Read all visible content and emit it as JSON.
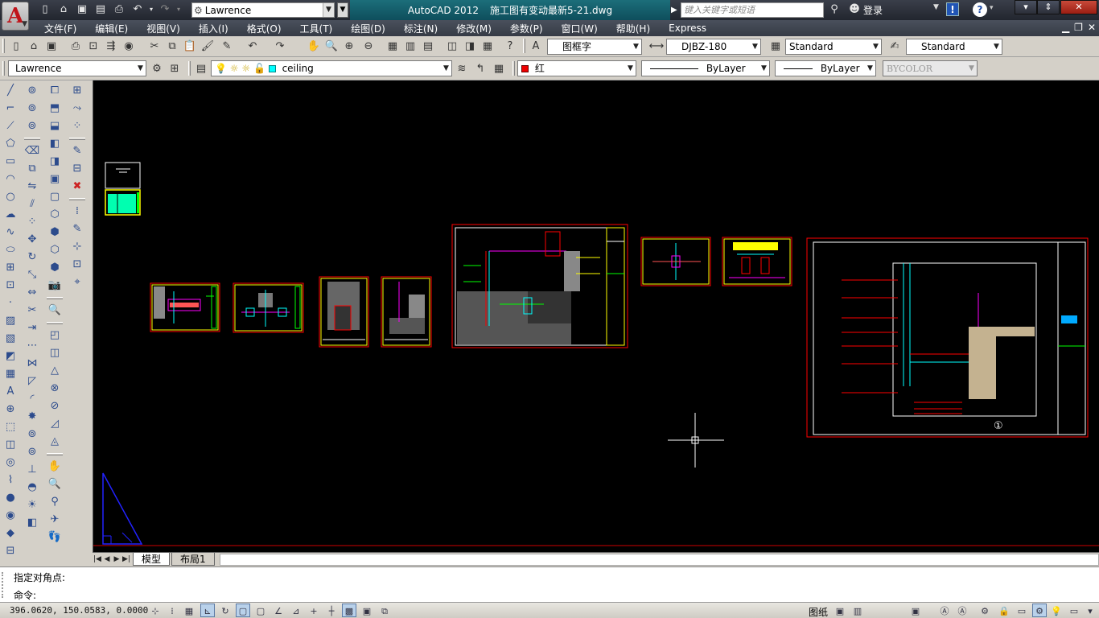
{
  "app": {
    "title": "AutoCAD 2012",
    "filename": "施工图有变动最新5-21.dwg",
    "logo_letter": "A"
  },
  "quick_access": {
    "workspace": "Lawrence",
    "icons": [
      "new-icon",
      "open-icon",
      "save-icon",
      "saveas-icon",
      "print-icon",
      "undo-icon",
      "redo-icon"
    ]
  },
  "search": {
    "placeholder": "键入关键字或短语"
  },
  "signin": {
    "label": "登录"
  },
  "menu": [
    "文件(F)",
    "编辑(E)",
    "视图(V)",
    "插入(I)",
    "格式(O)",
    "工具(T)",
    "绘图(D)",
    "标注(N)",
    "修改(M)",
    "参数(P)",
    "窗口(W)",
    "帮助(H)",
    "Express"
  ],
  "toolbar1": {
    "text_style": "图框字",
    "dim_style": "DJBZ-180",
    "table_style": "Standard",
    "multileader_style": "Standard"
  },
  "toolbar2": {
    "workspace": "Lawrence",
    "layer": "ceiling",
    "color": "红",
    "color_hex": "#ff0000",
    "linetype": "ByLayer",
    "lineweight": "ByLayer",
    "plotstyle": "BYCOLOR"
  },
  "tabs": {
    "model": "模型",
    "layout1": "布局1"
  },
  "command": {
    "history": "指定对角点:",
    "prompt": "命令:"
  },
  "status": {
    "coords": "396.0620, 150.0583, 0.0000",
    "model_label": "图纸"
  },
  "drawing": {
    "background": "#000000",
    "frame_color": "#ff0000",
    "titleblock_color": "#ffff00",
    "accent_cyan": "#00ffff",
    "accent_green": "#00ff00",
    "marker": "①"
  }
}
